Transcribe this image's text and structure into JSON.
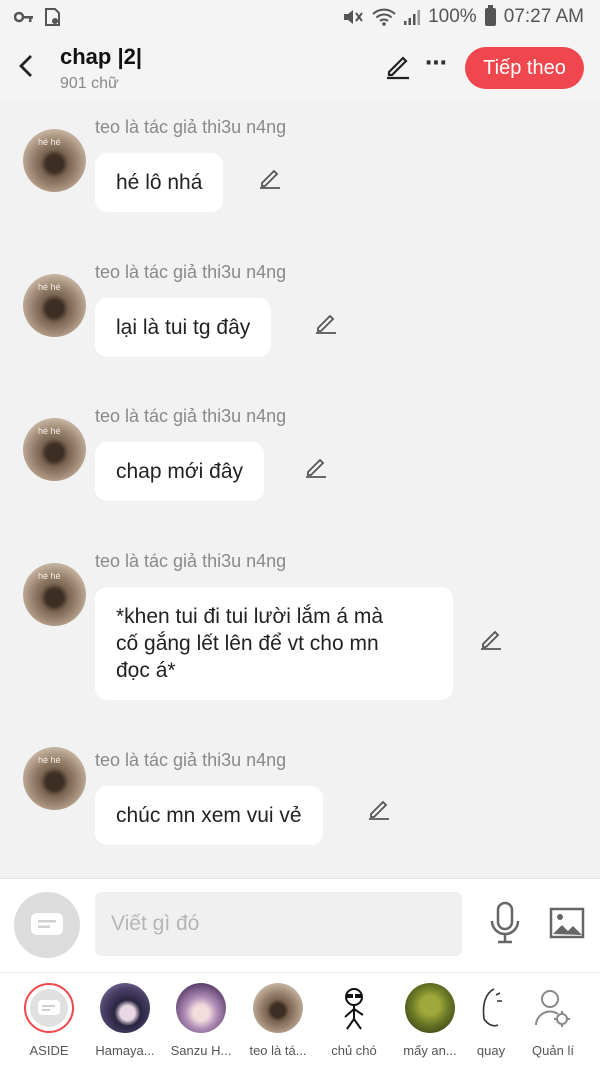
{
  "status": {
    "battery": "100%",
    "time": "07:27 AM"
  },
  "header": {
    "back_icon": "chevron-left-icon",
    "title": "chap |2|",
    "subtitle": "901 chữ",
    "next_label": "Tiếp theo",
    "accent": "#f0474e"
  },
  "messages": [
    {
      "author": "teo là tác giả thi3u n4ng",
      "lines": [
        "hé lô nhá"
      ]
    },
    {
      "author": "teo là tác giả thi3u n4ng",
      "lines": [
        "lại là tui tg đây"
      ]
    },
    {
      "author": "teo là tác giả thi3u n4ng",
      "lines": [
        "chap mới đây"
      ]
    },
    {
      "author": "teo là tác giả thi3u n4ng",
      "lines": [
        "*khen tui đi tui lười lắm á mà",
        "cố gắng lết lên để vt cho mn",
        "đọc á*"
      ]
    },
    {
      "author": "teo là tác giả thi3u n4ng",
      "lines": [
        "chúc mn xem vui vẻ"
      ]
    }
  ],
  "composer": {
    "placeholder": "Viết gì đó"
  },
  "characters": [
    {
      "label": "ASIDE"
    },
    {
      "label": "Hamaya..."
    },
    {
      "label": "Sanzu H..."
    },
    {
      "label": "teo là tá..."
    },
    {
      "label": "chủ chó"
    },
    {
      "label": "mấy an..."
    },
    {
      "label": "quay"
    },
    {
      "label": "Quản lí"
    }
  ]
}
